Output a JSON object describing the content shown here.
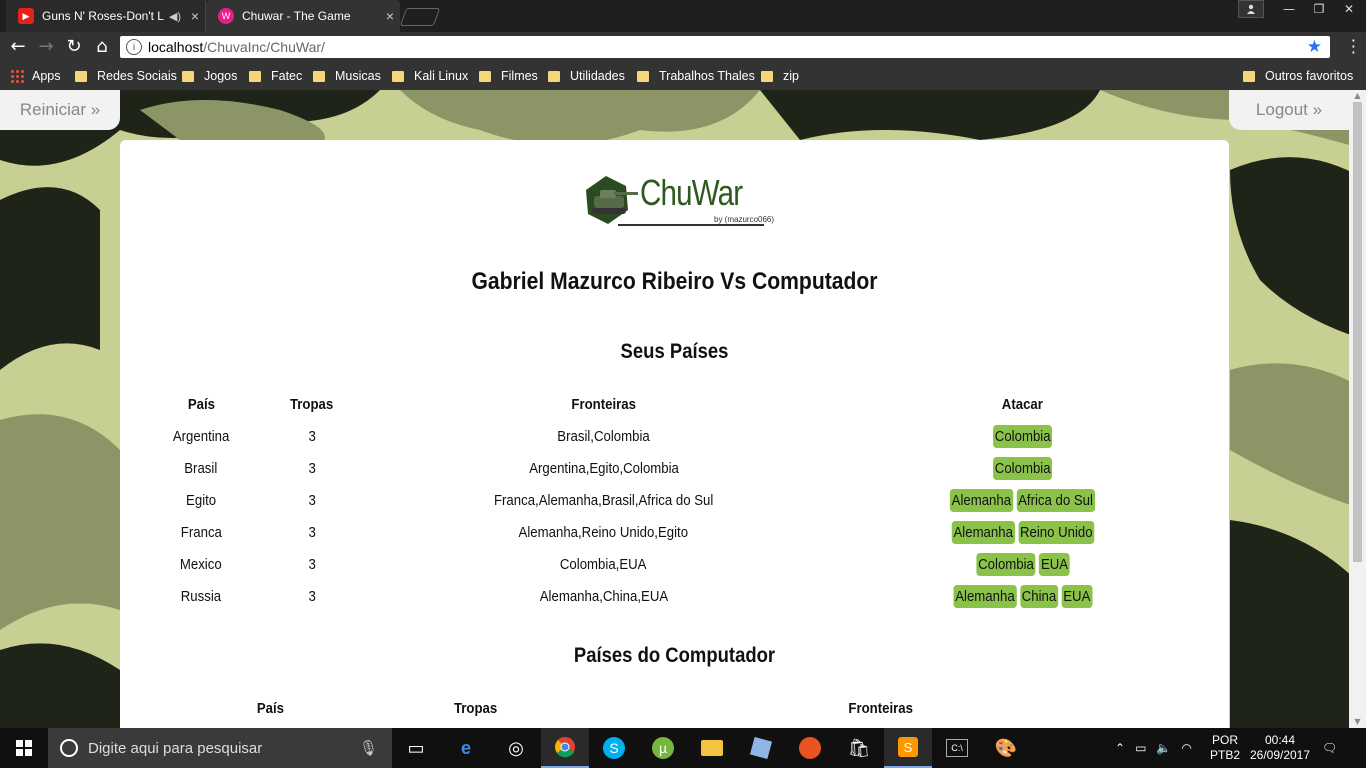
{
  "browser": {
    "tabs": [
      {
        "title": "Guns N' Roses-Don't L",
        "favicon": "youtube-icon",
        "muted_icon": "speaker-icon"
      },
      {
        "title": "Chuwar - The Game",
        "favicon": "chuwar-icon"
      }
    ],
    "url_host": "localhost",
    "url_path": "/ChuvaInc/ChuWar/",
    "bookmarks": [
      {
        "label": "Apps"
      },
      {
        "label": "Redes Sociais"
      },
      {
        "label": "Jogos"
      },
      {
        "label": "Fatec"
      },
      {
        "label": "Musicas"
      },
      {
        "label": "Kali Linux"
      },
      {
        "label": "Filmes"
      },
      {
        "label": "Utilidades"
      },
      {
        "label": "Trabalhos Thales"
      },
      {
        "label": "zip"
      },
      {
        "label": "Outros favoritos"
      }
    ]
  },
  "page": {
    "restart_label": "Reiniciar »",
    "logout_label": "Logout »",
    "logo_text": "ChuWar",
    "logo_by": "by (mazurco066)",
    "heading": "Gabriel Mazurco Ribeiro Vs Computador",
    "my_countries": {
      "title": "Seus Países",
      "headers": {
        "country": "País",
        "troops": "Tropas",
        "borders": "Fronteiras",
        "attack": "Atacar"
      },
      "rows": [
        {
          "country": "Argentina",
          "troops": "3",
          "borders": "Brasil,Colombia",
          "attack": [
            "Colombia"
          ]
        },
        {
          "country": "Brasil",
          "troops": "3",
          "borders": "Argentina,Egito,Colombia",
          "attack": [
            "Colombia"
          ]
        },
        {
          "country": "Egito",
          "troops": "3",
          "borders": "Franca,Alemanha,Brasil,Africa do Sul",
          "attack": [
            "Alemanha",
            "Africa do Sul"
          ]
        },
        {
          "country": "Franca",
          "troops": "3",
          "borders": "Alemanha,Reino Unido,Egito",
          "attack": [
            "Alemanha",
            "Reino Unido"
          ]
        },
        {
          "country": "Mexico",
          "troops": "3",
          "borders": "Colombia,EUA",
          "attack": [
            "Colombia",
            "EUA"
          ]
        },
        {
          "country": "Russia",
          "troops": "3",
          "borders": "Alemanha,China,EUA",
          "attack": [
            "Alemanha",
            "China",
            "EUA"
          ]
        }
      ]
    },
    "cpu_countries": {
      "title": "Países do Computador",
      "headers": {
        "country": "País",
        "troops": "Tropas",
        "borders": "Fronteiras"
      }
    }
  },
  "taskbar": {
    "search_placeholder": "Digite aqui para pesquisar",
    "language": "POR",
    "layout": "PTB2",
    "time": "00:44",
    "date": "26/09/2017"
  },
  "colors": {
    "attack_button": "#8bc34a",
    "camo_light": "#c8cf92",
    "camo_mid": "#8c9566",
    "camo_dark": "#1f2419"
  }
}
